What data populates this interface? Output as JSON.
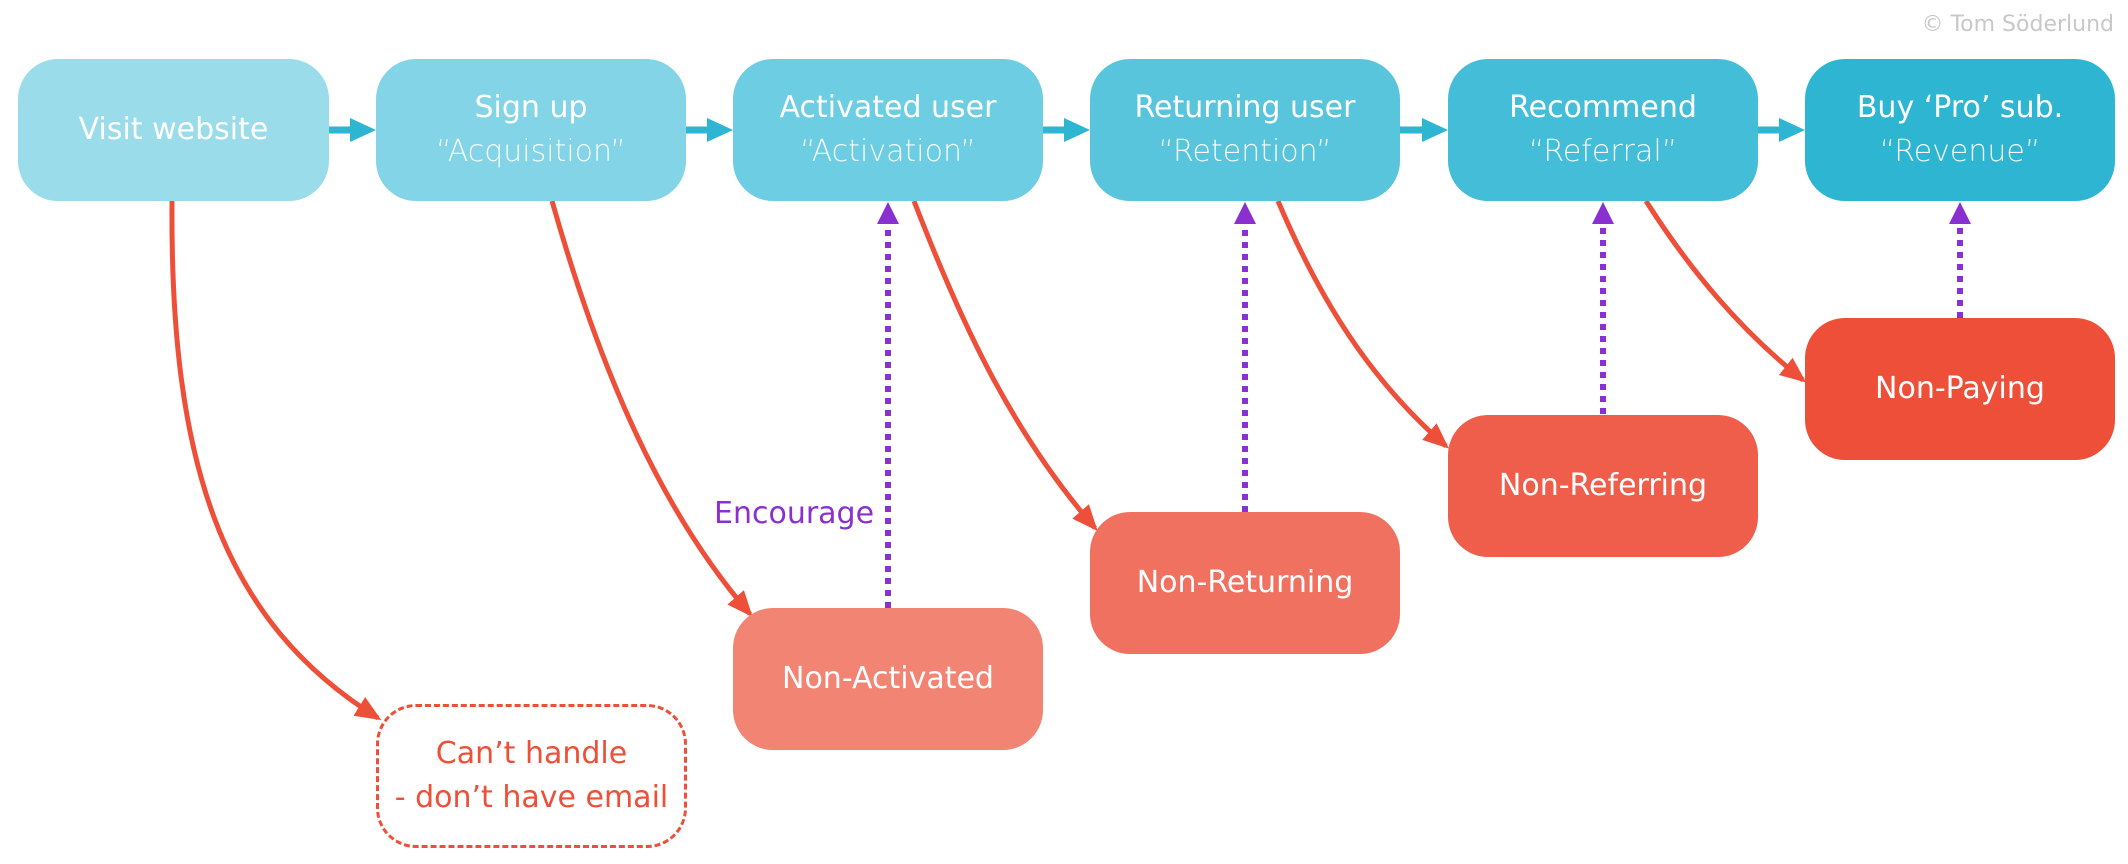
{
  "copyright": "© Tom Söderlund",
  "funnel": [
    {
      "id": "visit",
      "title": "Visit website",
      "subtitle": "",
      "color": "#9adce9"
    },
    {
      "id": "signup",
      "title": "Sign up",
      "subtitle": "“Acquisition”",
      "color": "#82d4e6"
    },
    {
      "id": "activated",
      "title": "Activated user",
      "subtitle": "“Activation”",
      "color": "#6ccde3"
    },
    {
      "id": "returning",
      "title": "Returning user",
      "subtitle": "“Retention”",
      "color": "#58c5dd"
    },
    {
      "id": "recommend",
      "title": "Recommend",
      "subtitle": "“Referral”",
      "color": "#43bdd8"
    },
    {
      "id": "buypro",
      "title": "Buy ‘Pro’ sub.",
      "subtitle": "“Revenue”",
      "color": "#2db5d2"
    }
  ],
  "dropoffs": [
    {
      "id": "cant-handle",
      "lines": [
        "Can’t handle",
        "- don’t have email"
      ],
      "style": "dashed",
      "color": "#ee4f38"
    },
    {
      "id": "non-activated",
      "label": "Non-Activated",
      "color": "#f28473"
    },
    {
      "id": "non-returning",
      "label": "Non-Returning",
      "color": "#f07160"
    },
    {
      "id": "non-referring",
      "label": "Non-Referring",
      "color": "#ef5e4b"
    },
    {
      "id": "non-paying",
      "label": "Non-Paying",
      "color": "#ee4f38"
    }
  ],
  "encourage_label": "Encourage",
  "colors": {
    "flow_arrow": "#2db5d2",
    "dropoff_arrow": "#ee4f38",
    "encourage_arrow": "#8a2fd0"
  }
}
